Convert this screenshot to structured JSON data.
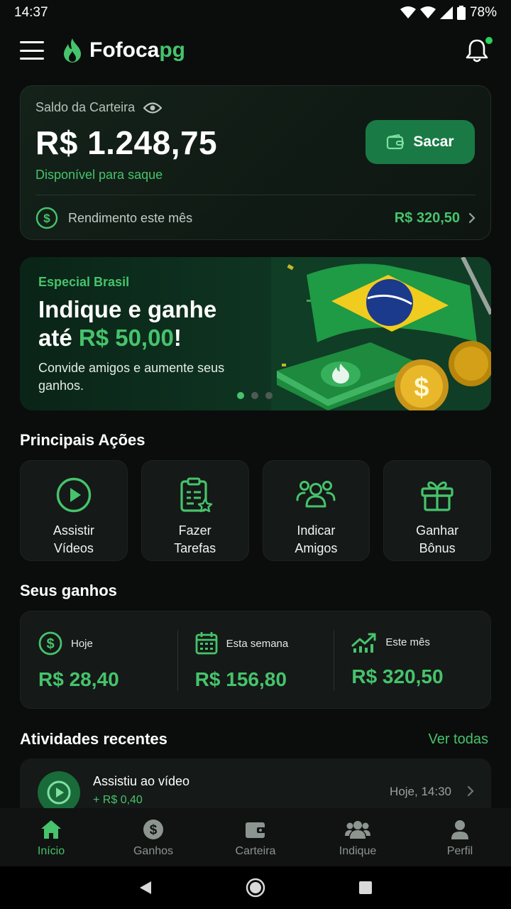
{
  "status_bar": {
    "time": "14:37",
    "battery": "78%"
  },
  "header": {
    "brand_part1": "Fofoca",
    "brand_part2": "pg"
  },
  "wallet": {
    "label": "Saldo da Carteira",
    "balance": "R$ 1.248,75",
    "available": "Disponível para saque",
    "withdraw_label": "Sacar",
    "income_label": "Rendimento este mês",
    "income_value": "R$ 320,50"
  },
  "banner": {
    "kicker": "Especial Brasil",
    "title_line1": "Indique e ganhe",
    "title_prefix": "até ",
    "title_highlight": "R$ 50,00",
    "title_suffix": "!",
    "subtitle": "Convide amigos e aumente seus ganhos."
  },
  "actions": {
    "title": "Principais Ações",
    "items": [
      {
        "label": "Assistir\nVídeos",
        "icon": "play-circle-icon"
      },
      {
        "label": "Fazer\nTarefas",
        "icon": "clipboard-star-icon"
      },
      {
        "label": "Indicar\nAmigos",
        "icon": "users-icon"
      },
      {
        "label": "Ganhar\nBônus",
        "icon": "gift-icon"
      }
    ]
  },
  "earnings": {
    "title": "Seus ganhos",
    "items": [
      {
        "label": "Hoje",
        "value": "R$ 28,40",
        "icon": "dollar-circle-icon"
      },
      {
        "label": "Esta semana",
        "value": "R$ 156,80",
        "icon": "calendar-icon"
      },
      {
        "label": "Este mês",
        "value": "R$ 320,50",
        "icon": "trend-up-icon"
      }
    ]
  },
  "activities": {
    "title": "Atividades recentes",
    "see_all": "Ver todas",
    "items": [
      {
        "title": "Assistiu ao vídeo",
        "amount": "+ R$ 0,40",
        "time": "Hoje, 14:30"
      }
    ]
  },
  "bottom_nav": {
    "items": [
      {
        "label": "Início",
        "icon": "home-icon",
        "active": true
      },
      {
        "label": "Ganhos",
        "icon": "dollar-icon"
      },
      {
        "label": "Carteira",
        "icon": "wallet-icon"
      },
      {
        "label": "Indique",
        "icon": "users-icon"
      },
      {
        "label": "Perfil",
        "icon": "profile-icon"
      }
    ]
  },
  "colors": {
    "accent": "#46c36c",
    "background": "#0b0d0c",
    "card": "#151917",
    "button": "#1a7a45"
  }
}
